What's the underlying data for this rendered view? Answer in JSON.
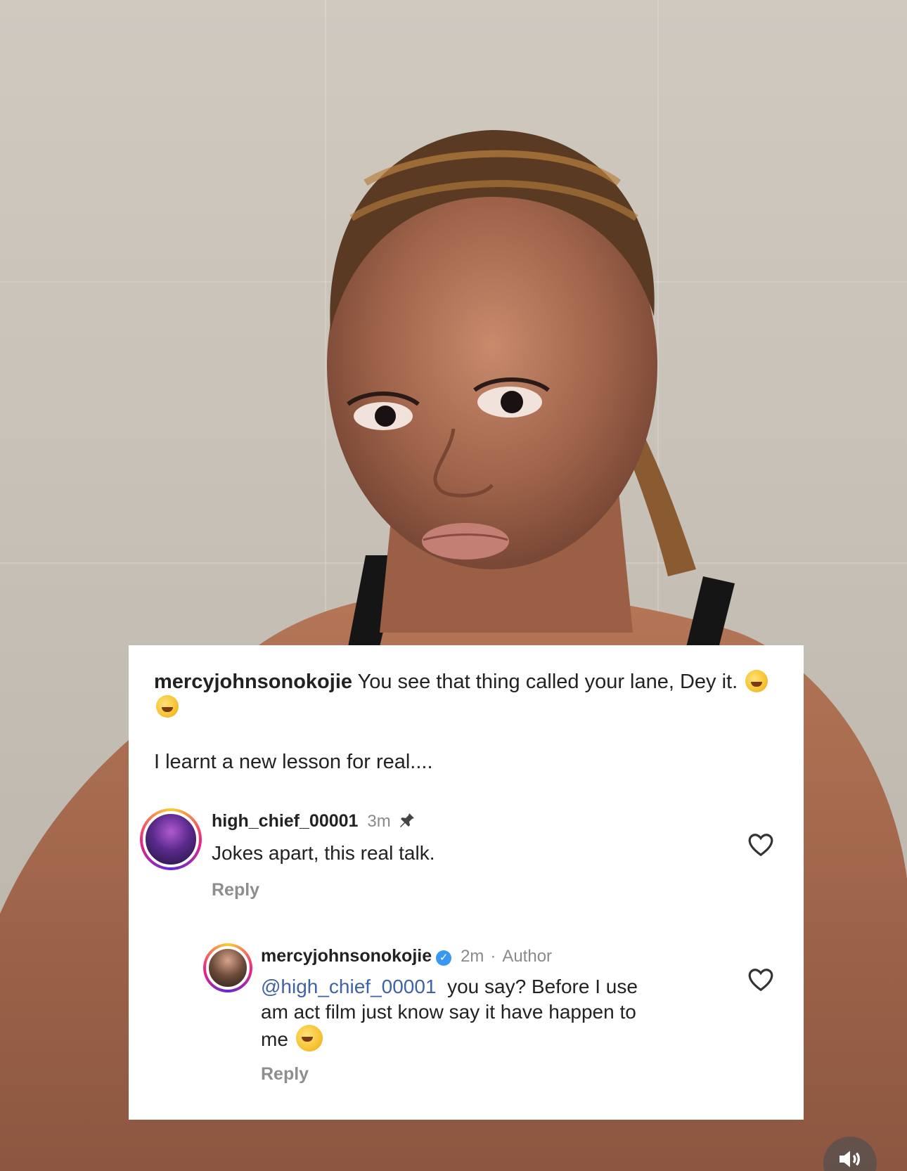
{
  "post_caption": {
    "username": "mercyjohnsonokojie",
    "text": "You see that thing called your lane, Dey it.",
    "emojis": [
      "rolling-on-floor-laughing",
      "rolling-on-floor-laughing"
    ],
    "line2": "I learnt a new lesson for real...."
  },
  "comments": [
    {
      "username": "high_chief_00001",
      "time": "3m",
      "pinned_icon": "pin-icon",
      "text": "Jokes apart, this real talk.",
      "reply_label": "Reply",
      "like_icon": "heart-icon"
    },
    {
      "username": "mercyjohnsonokojie",
      "verified_icon": "verified-badge-icon",
      "time": "2m",
      "separator": "·",
      "role": "Author",
      "mention": "@high_chief_00001",
      "text_line1": "you say? Before I use",
      "text_line2": "am act film just know say it have happen to",
      "text_line3": "me",
      "emoji": "face-with-tears-of-joy",
      "reply_label": "Reply",
      "like_icon": "heart-icon"
    }
  ],
  "controls": {
    "sound_icon": "speaker-icon"
  },
  "colors": {
    "mention": "#3f62a8",
    "verified": "#3897f0",
    "meta_gray": "#8e8e8e"
  }
}
